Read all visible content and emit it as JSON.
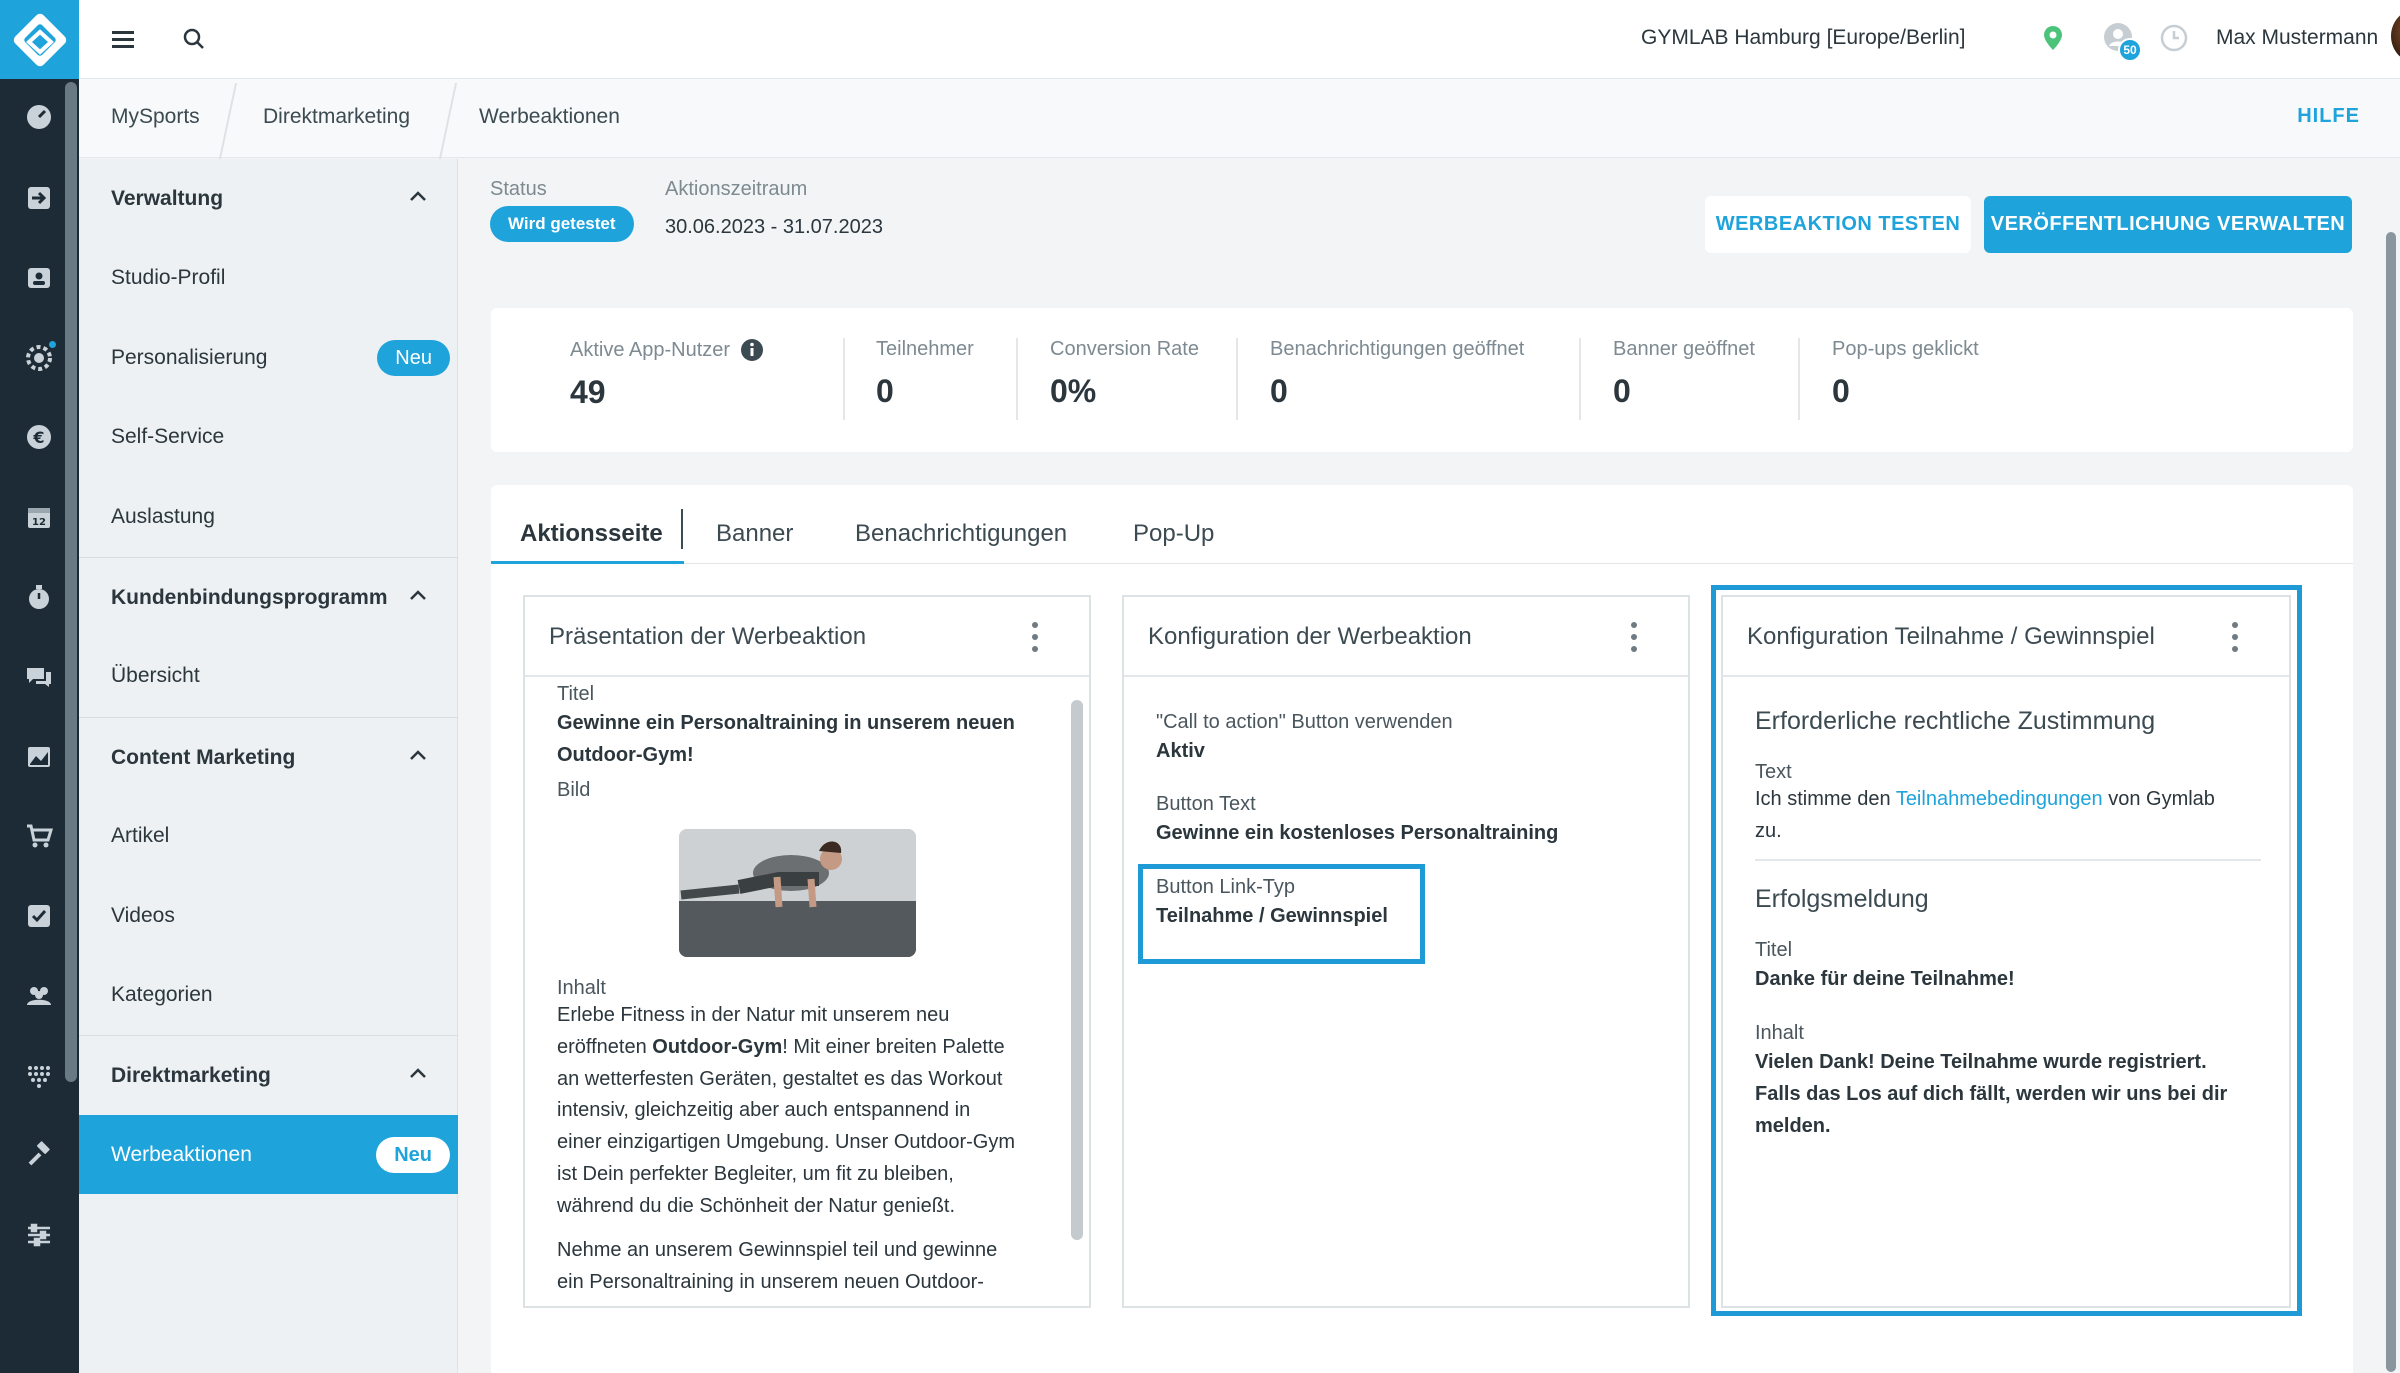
{
  "topbar": {
    "location": "GYMLAB Hamburg [Europe/Berlin]",
    "notification_count": "50",
    "user_name": "Max Mustermann"
  },
  "breadcrumb": [
    "MySports",
    "Direktmarketing",
    "Werbeaktionen"
  ],
  "help_label": "HILFE",
  "sidebar": {
    "sections": [
      {
        "title": "Verwaltung",
        "items": [
          {
            "label": "Studio-Profil"
          },
          {
            "label": "Personalisierung",
            "badge": "Neu"
          },
          {
            "label": "Self-Service"
          },
          {
            "label": "Auslastung"
          }
        ]
      },
      {
        "title": "Kundenbindungsprogramm",
        "items": [
          {
            "label": "Übersicht"
          }
        ]
      },
      {
        "title": "Content Marketing",
        "items": [
          {
            "label": "Artikel"
          },
          {
            "label": "Videos"
          },
          {
            "label": "Kategorien"
          }
        ]
      },
      {
        "title": "Direktmarketing",
        "items": [
          {
            "label": "Werbeaktionen",
            "badge": "Neu"
          }
        ]
      }
    ]
  },
  "header": {
    "status_label": "Status",
    "status_value": "Wird getestet",
    "period_label": "Aktionszeitraum",
    "period_value": "30.06.2023 - 31.07.2023",
    "test_button": "WERBEAKTION TESTEN",
    "publish_button": "VERÖFFENTLICHUNG VERWALTEN"
  },
  "kpis": [
    {
      "label": "Aktive App-Nutzer",
      "value": "49"
    },
    {
      "label": "Teilnehmer",
      "value": "0"
    },
    {
      "label": "Conversion Rate",
      "value": "0%"
    },
    {
      "label": "Benachrichtigungen geöffnet",
      "value": "0"
    },
    {
      "label": "Banner geöffnet",
      "value": "0"
    },
    {
      "label": "Pop-ups geklickt",
      "value": "0"
    }
  ],
  "tabs": [
    "Aktionsseite",
    "Banner",
    "Benachrichtigungen",
    "Pop-Up"
  ],
  "panel_presentation": {
    "title": "Präsentation der Werbeaktion",
    "title_label": "Titel",
    "title_value_1": "Gewinne ein Personaltraining in unserem neuen",
    "title_value_2": "Outdoor-Gym!",
    "image_label": "Bild",
    "content_label": "Inhalt",
    "content_lines": [
      "Erlebe Fitness in der Natur mit unserem neu",
      "eröffneten ",
      "Outdoor-Gym",
      "! Mit einer breiten Palette",
      "an wetterfesten Geräten, gestaltet es das Workout",
      "intensiv, gleichzeitig aber auch entspannend in",
      "einer einzigartigen Umgebung. Unser Outdoor-Gym",
      "ist Dein perfekter Begleiter, um fit zu bleiben,",
      "während du die Schönheit der Natur genießt.",
      "Nehme an unserem Gewinnspiel teil und gewinne",
      "ein Personaltraining in unserem neuen Outdoor-"
    ]
  },
  "panel_config": {
    "title": "Konfiguration der Werbeaktion",
    "cta_label": "\"Call to action\" Button verwenden",
    "cta_value": "Aktiv",
    "button_text_label": "Button Text",
    "button_text_value": "Gewinne ein kostenloses Personaltraining",
    "link_type_label": "Button Link-Typ",
    "link_type_value": "Teilnahme / Gewinnspiel"
  },
  "panel_participation": {
    "title": "Konfiguration Teilnahme / Gewinnspiel",
    "consent_heading": "Erforderliche rechtliche Zustimmung",
    "text_label": "Text",
    "consent_pre": "Ich stimme den ",
    "consent_link": "Teilnahmebedingungen",
    "consent_post": " von Gymlab",
    "consent_post_2": "zu.",
    "success_heading": "Erfolgsmeldung",
    "success_title_label": "Titel",
    "success_title_value": "Danke für deine Teilnahme!",
    "success_content_label": "Inhalt",
    "success_content_lines": [
      "Vielen Dank! Deine Teilnahme wurde registriert.",
      "Falls das Los auf dich fällt, werden wir uns bei dir",
      "melden."
    ]
  },
  "colors": {
    "accent": "#1ea3db",
    "rail": "#1d2b36",
    "highlight": "#1e9bd7"
  }
}
